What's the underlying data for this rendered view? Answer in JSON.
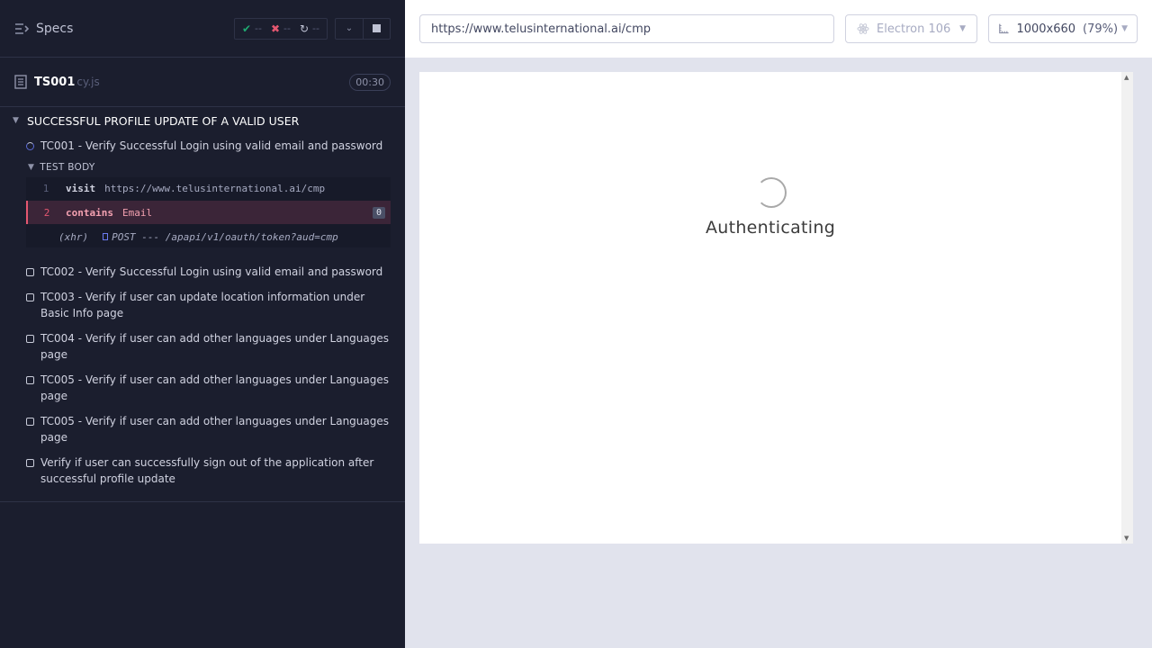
{
  "header": {
    "specs_label": "Specs",
    "passed": "--",
    "failed": "--",
    "pending": "--"
  },
  "spec": {
    "name": "TS001",
    "ext": "cy.js",
    "duration": "00:30"
  },
  "suite": {
    "title": "SUCCESSFUL PROFILE UPDATE OF A VALID USER"
  },
  "tests": [
    {
      "title": "TC001 - Verify Successful Login using valid email and password",
      "state": "running"
    },
    {
      "title": "TC002 - Verify Successful Login using valid email and password",
      "state": "pending"
    },
    {
      "title": "TC003 - Verify if user can update location information under Basic Info page",
      "state": "pending"
    },
    {
      "title": "TC004 - Verify if user can add other languages under Languages page",
      "state": "pending"
    },
    {
      "title": "TC005 - Verify if user can add other languages under Languages page",
      "state": "pending"
    },
    {
      "title": "TC005 - Verify if user can add other languages under Languages page",
      "state": "pending"
    },
    {
      "title": "Verify if user can successfully sign out of the application after successful profile update",
      "state": "pending"
    }
  ],
  "test_body": {
    "label": "TEST BODY",
    "commands": [
      {
        "num": "1",
        "name": "visit",
        "message": "https://www.telusinternational.ai/cmp"
      },
      {
        "num": "2",
        "name": "contains",
        "message": "Email",
        "badge": "0"
      },
      {
        "num": "",
        "name": "(xhr)",
        "message": "POST --- /apapi/v1/oauth/token?aud=cmp"
      }
    ]
  },
  "toolbar": {
    "url": "https://www.telusinternational.ai/cmp",
    "browser": "Electron 106",
    "viewport": "1000x660",
    "zoom": "(79%)"
  },
  "aut": {
    "status_text": "Authenticating"
  },
  "colors": {
    "sidebar_bg": "#1b1e2e",
    "fail_accent": "#e45770",
    "pass_green": "#1fa971"
  }
}
